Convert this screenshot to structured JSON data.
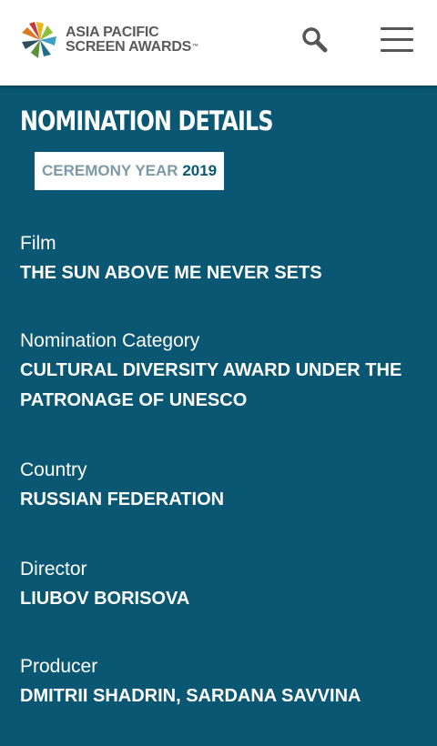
{
  "header": {
    "logo_line1": "ASIA PACIFIC",
    "logo_line2": "SCREEN AWARDS",
    "logo_tm": "™"
  },
  "page": {
    "title": "NOMINATION DETAILS",
    "year_label": "CEREMONY YEAR",
    "year_value": "2019"
  },
  "fields": [
    {
      "label": "Film",
      "value": "THE SUN ABOVE ME NEVER SETS"
    },
    {
      "label": "Nomination Category",
      "value": "CULTURAL DIVERSITY AWARD UNDER THE PATRONAGE OF UNESCO"
    },
    {
      "label": "Country",
      "value": "RUSSIAN FEDERATION"
    },
    {
      "label": "Director",
      "value": "LIUBOV BORISOVA"
    },
    {
      "label": "Producer",
      "value": "DMITRII SHADRIN, SARDANA SAVVINA"
    }
  ],
  "colors": {
    "background": "#0a5773",
    "header_bg": "#ffffff",
    "text": "#ffffff",
    "year_label": "#7c9aa6"
  },
  "icons": {
    "logo": "asia-pacific-screen-awards-star-logo",
    "search": "search-icon",
    "menu": "hamburger-menu-icon"
  }
}
